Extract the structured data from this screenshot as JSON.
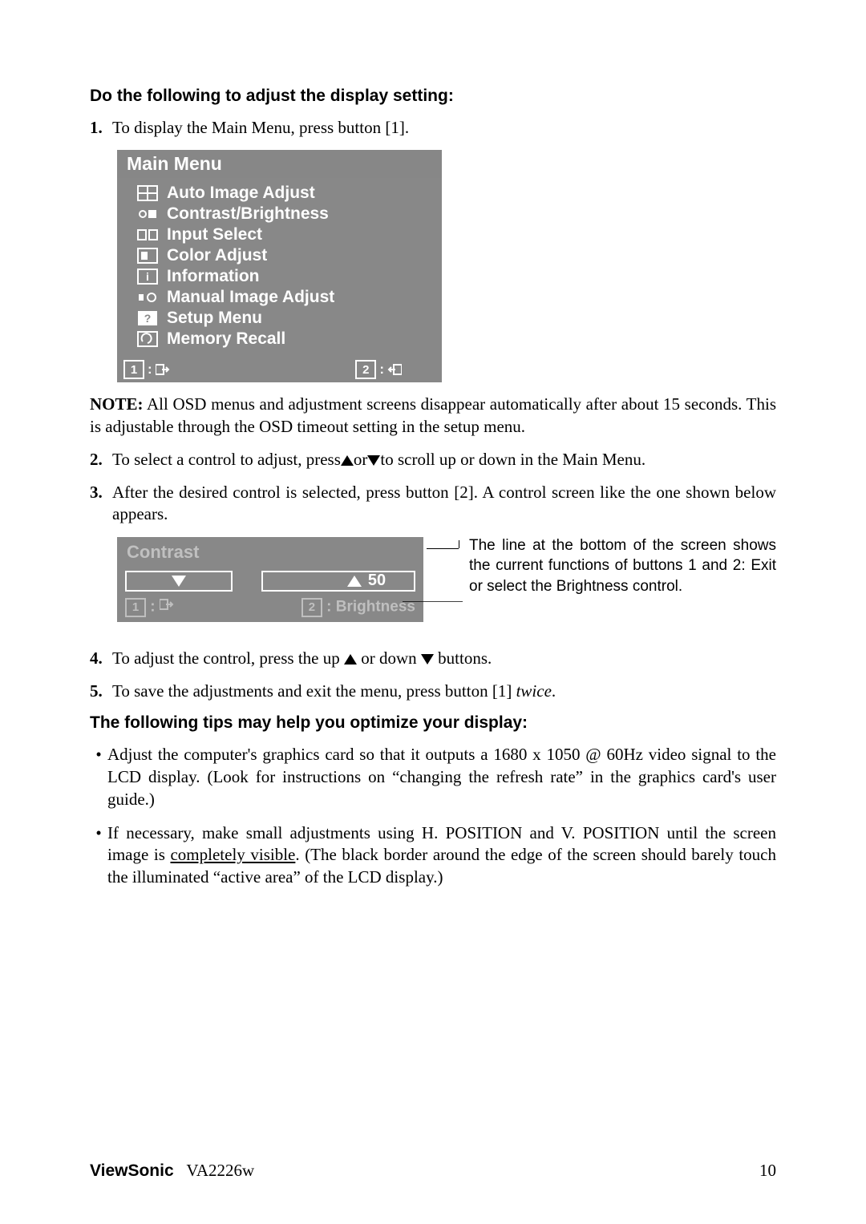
{
  "heading1": "Do the following to adjust the display setting:",
  "steps_a": [
    {
      "n": "1.",
      "t": "To display the Main Menu, press button [1]."
    }
  ],
  "osd": {
    "title": "Main Menu",
    "items": [
      "Auto Image Adjust",
      "Contrast/Brightness",
      "Input Select",
      "Color Adjust",
      "Information",
      "Manual Image Adjust",
      "Setup Menu",
      "Memory Recall"
    ],
    "foot1": "1",
    "foot2": "2"
  },
  "note_bold": "NOTE:",
  "note_rest": " All OSD menus and adjustment screens disappear automatically after about 15 seconds. This is adjustable through the OSD timeout setting in the setup menu.",
  "steps_b": [
    {
      "n": "2.",
      "pre": "To select a control to adjust, press",
      "mid": "or",
      "post": "to scroll up or down in the Main Menu."
    },
    {
      "n": "3.",
      "t": "After the desired control is selected, press button [2]. A control screen like the one shown below appears."
    }
  ],
  "contrast": {
    "title": "Contrast",
    "value": "50",
    "foot_left_num": "1",
    "foot_right_num": "2",
    "foot_right_label": ": Brightness"
  },
  "annotation": "The line at the bottom of the screen shows the current functions of buttons 1 and 2: Exit or select the Brightness control.",
  "steps_c": [
    {
      "n": "4.",
      "pre": "To adjust the control, press the up ",
      "mid": " or down ",
      "post": " buttons."
    },
    {
      "n": "5.",
      "pre": "To save the adjustments and exit the menu, press button [1] ",
      "ital": "twice",
      "post": "."
    }
  ],
  "heading2": "The following tips may help you optimize your display:",
  "tips": [
    "Adjust the computer's graphics card so that it outputs a 1680 x 1050 @ 60Hz video signal to the LCD display. (Look for instructions on “changing the refresh rate” in the graphics card's user guide.)",
    {
      "pre": "If necessary, make small adjustments using H. POSITION and V. POSITION until the screen image is ",
      "ul": "completely visible",
      "post": ". (The black border around the edge of the screen should barely touch the illuminated “active area” of the LCD display.)"
    }
  ],
  "footer_brand": "ViewSonic",
  "footer_model": "VA2226w",
  "footer_page": "10"
}
